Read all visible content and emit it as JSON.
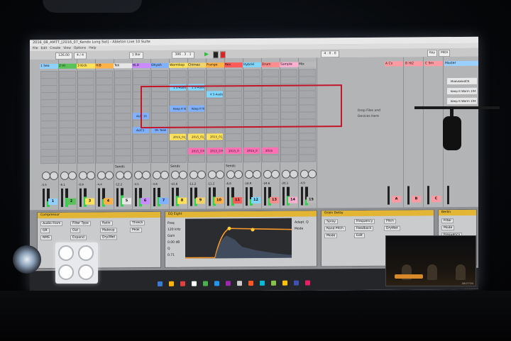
{
  "window": {
    "title": "2016_08_AMTT_[2016_07_Kendo Long Set] - Ableton Live 10 Suite",
    "menu": [
      "File",
      "Edit",
      "Create",
      "View",
      "Options",
      "Help"
    ]
  },
  "transport": {
    "tempo": "126.00",
    "signature": "4 / 4",
    "quantize": "1 Bar",
    "position": "386 . 3 . 1",
    "loop_length": "4 . 0 . 0",
    "key_label": "Key",
    "midi_label": "MIDI"
  },
  "tracks": [
    {
      "name": "1 Sea",
      "color": "#8fd0ff"
    },
    {
      "name": "2 Hi",
      "color": "#59c35a"
    },
    {
      "name": "3 Kick",
      "color": "#ffe15a"
    },
    {
      "name": "HiB",
      "color": "#ffb347"
    },
    {
      "name": "Tek",
      "color": "#e6e6e6"
    },
    {
      "name": "BLD",
      "color": "#c98bff"
    },
    {
      "name": "Ohyah",
      "color": "#7fb1ff"
    },
    {
      "name": "Warmkop",
      "color": "#ffe15a"
    },
    {
      "name": "Chimez",
      "color": "#f0d36a"
    },
    {
      "name": "Frange",
      "color": "#ffb347"
    },
    {
      "name": "Rev",
      "color": "#ff5a5a"
    },
    {
      "name": "Hybrid",
      "color": "#7fd6ff"
    },
    {
      "name": "Drum",
      "color": "#ff8c8c"
    },
    {
      "name": "Sample",
      "color": "#ffb0d0"
    },
    {
      "name": "Mix",
      "color": "#b9b9b9"
    }
  ],
  "returns": [
    {
      "name": "A Cx",
      "color": "#ff9aa2"
    },
    {
      "name": "B Hi2",
      "color": "#ff9aa2"
    },
    {
      "name": "C Srn",
      "color": "#ff9aa2"
    },
    {
      "name": "Master",
      "color": "#9ad0ff"
    }
  ],
  "clips": [
    {
      "text": "1 5-Audio",
      "color": "#7fd6ff"
    },
    {
      "text": "1 5-Audio",
      "color": "#7fd6ff"
    },
    {
      "text": "4 5-Audio",
      "color": "#7fd6ff"
    },
    {
      "text": "ALIT 15",
      "color": "#7fb1ff"
    },
    {
      "text": "Keep It Warm 1",
      "color": "#7fb1ff"
    },
    {
      "text": "Keep It Warm 1",
      "color": "#7fb1ff"
    },
    {
      "text": "ALIC1",
      "color": "#7fb1ff"
    },
    {
      "text": "Oh Yeah",
      "color": "#7fb1ff"
    },
    {
      "text": "2015_01_20 42_20",
      "color": "#ffe15a"
    },
    {
      "text": "2015_01_20 42_20",
      "color": "#ffe15a"
    },
    {
      "text": "2015_01_20 42_20",
      "color": "#ffe15a"
    },
    {
      "text": "2015_0708_ohyyd",
      "color": "#ff6fb5"
    },
    {
      "text": "2015_0708_ohypp",
      "color": "#ff6fb5"
    },
    {
      "text": "2015_0",
      "color": "#ff6fb5"
    },
    {
      "text": "2015_0",
      "color": "#ff6fb5"
    },
    {
      "text": "2015",
      "color": "#ff6fb5"
    }
  ],
  "master_clips": [
    "ModulatedCE",
    "Keep It Warm 104",
    "Keep It Warm 104"
  ],
  "browser_drop": [
    "Drop Files and",
    "Devices Here"
  ],
  "sends_label": "Sends",
  "track_numbers": [
    "1",
    "2",
    "3",
    "4",
    "5",
    "6",
    "7",
    "8",
    "9",
    "10",
    "11",
    "12",
    "13",
    "14",
    "15"
  ],
  "return_letters": [
    "A",
    "B",
    "C"
  ],
  "volume_values": [
    "-5.5",
    "-6.1",
    "-0.9",
    "-4.4",
    "-12.2",
    "-4.5",
    "-3.8",
    "-15.6",
    "-11.2",
    "-11.2",
    "-6.8",
    "-16.9",
    "-24.6",
    "-20.1",
    "-4.9"
  ],
  "meter_levels": [
    0.3,
    0.5,
    0.55,
    0.4,
    0.6,
    0.45,
    0.5,
    0.55,
    0.4,
    0.5,
    0.45,
    0.35,
    0.4,
    0.5,
    0.3
  ],
  "devices": {
    "compressor": {
      "title": "Compressor",
      "labels": [
        "Audio From",
        "Filter Type",
        "Ratio",
        "Thresh",
        "GR",
        "Out",
        "Makeup",
        "Peak",
        "RMS",
        "Expand",
        "Dry/Wet"
      ]
    },
    "eq": {
      "title": "EQ Eight",
      "labels": [
        "Freq",
        "Gain",
        "Q",
        "Adapt. Q",
        "Mode"
      ],
      "freq": "120 kHz",
      "gain": "0.00 dB",
      "q": "0.71"
    },
    "delay": {
      "title": "Grain Delay",
      "labels": [
        "Spray",
        "Frequency",
        "Pitch",
        "Rand Pitch",
        "Feedback",
        "DryWet",
        "Mode",
        "Edit"
      ]
    },
    "filter": {
      "title": "Berlin",
      "labels": [
        "Filter",
        "Mode",
        "Frequency",
        "Decay"
      ]
    }
  },
  "webcam_label": "ABLETON",
  "colors": {
    "accent": "#e2b534",
    "highlight_box": "#c4162a",
    "play": "#2bbf3a",
    "meter_green": "#2fd14a"
  }
}
